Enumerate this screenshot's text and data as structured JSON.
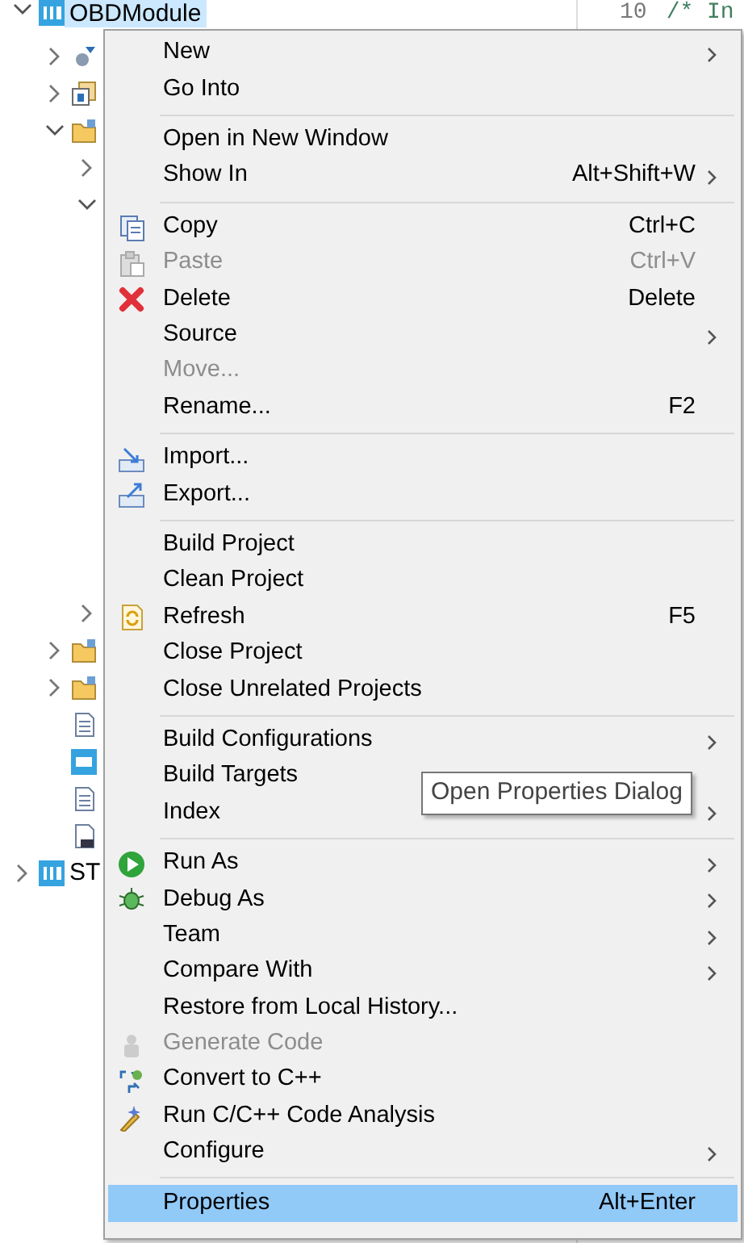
{
  "tree": [
    {
      "label": "OBDModule",
      "selected": true,
      "expanded": true,
      "children": [
        {
          "expanded": false,
          "selected": false
        },
        {
          "expanded": false,
          "selected": false
        },
        {
          "expanded": true,
          "selected": false,
          "children": [
            {
              "expanded": false,
              "selected": false
            },
            {
              "expanded": true,
              "selected": false
            },
            {
              "expanded": false,
              "selected": false
            }
          ]
        },
        {
          "expanded": false,
          "selected": false
        },
        {
          "expanded": false,
          "selected": false
        },
        {
          "selected": false
        },
        {
          "selected": false
        },
        {
          "selected": false
        },
        {
          "selected": false
        }
      ]
    },
    {
      "label": "ST",
      "selected": false,
      "expanded": false
    }
  ],
  "editor": {
    "line_number": "10",
    "code": "/* In"
  },
  "context_menu": [
    {
      "kind": "item",
      "label": "New",
      "submenu": true,
      "disabled": false,
      "selected": false
    },
    {
      "kind": "item",
      "label": "Go Into",
      "submenu": false,
      "disabled": false,
      "selected": false
    },
    {
      "kind": "separator"
    },
    {
      "kind": "item",
      "label": "Open in New Window",
      "submenu": false,
      "disabled": false,
      "selected": false
    },
    {
      "kind": "item",
      "label": "Show In",
      "shortcut": "Alt+Shift+W",
      "submenu": true,
      "disabled": false,
      "selected": false
    },
    {
      "kind": "separator"
    },
    {
      "kind": "item",
      "label": "Copy",
      "shortcut": "Ctrl+C",
      "submenu": false,
      "disabled": false,
      "selected": false
    },
    {
      "kind": "item",
      "label": "Paste",
      "shortcut": "Ctrl+V",
      "submenu": false,
      "disabled": true,
      "selected": false
    },
    {
      "kind": "item",
      "label": "Delete",
      "shortcut": "Delete",
      "submenu": false,
      "disabled": false,
      "selected": false
    },
    {
      "kind": "item",
      "label": "Source",
      "submenu": true,
      "disabled": false,
      "selected": false
    },
    {
      "kind": "item",
      "label": "Move...",
      "submenu": false,
      "disabled": true,
      "selected": false
    },
    {
      "kind": "item",
      "label": "Rename...",
      "shortcut": "F2",
      "submenu": false,
      "disabled": false,
      "selected": false
    },
    {
      "kind": "separator"
    },
    {
      "kind": "item",
      "label": "Import...",
      "submenu": false,
      "disabled": false,
      "selected": false
    },
    {
      "kind": "item",
      "label": "Export...",
      "submenu": false,
      "disabled": false,
      "selected": false
    },
    {
      "kind": "separator"
    },
    {
      "kind": "item",
      "label": "Build Project",
      "submenu": false,
      "disabled": false,
      "selected": false
    },
    {
      "kind": "item",
      "label": "Clean Project",
      "submenu": false,
      "disabled": false,
      "selected": false
    },
    {
      "kind": "item",
      "label": "Refresh",
      "shortcut": "F5",
      "submenu": false,
      "disabled": false,
      "selected": false
    },
    {
      "kind": "item",
      "label": "Close Project",
      "submenu": false,
      "disabled": false,
      "selected": false
    },
    {
      "kind": "item",
      "label": "Close Unrelated Projects",
      "submenu": false,
      "disabled": false,
      "selected": false
    },
    {
      "kind": "separator"
    },
    {
      "kind": "item",
      "label": "Build Configurations",
      "submenu": true,
      "disabled": false,
      "selected": false
    },
    {
      "kind": "item",
      "label": "Build Targets",
      "submenu": false,
      "disabled": false,
      "selected": false
    },
    {
      "kind": "item",
      "label": "Index",
      "submenu": true,
      "disabled": false,
      "selected": false
    },
    {
      "kind": "separator"
    },
    {
      "kind": "item",
      "label": "Run As",
      "submenu": true,
      "disabled": false,
      "selected": false
    },
    {
      "kind": "item",
      "label": "Debug As",
      "submenu": true,
      "disabled": false,
      "selected": false
    },
    {
      "kind": "item",
      "label": "Team",
      "submenu": true,
      "disabled": false,
      "selected": false
    },
    {
      "kind": "item",
      "label": "Compare With",
      "submenu": true,
      "disabled": false,
      "selected": false
    },
    {
      "kind": "item",
      "label": "Restore from Local History...",
      "submenu": false,
      "disabled": false,
      "selected": false
    },
    {
      "kind": "item",
      "label": "Generate Code",
      "submenu": false,
      "disabled": true,
      "selected": false
    },
    {
      "kind": "item",
      "label": "Convert to C++",
      "submenu": false,
      "disabled": false,
      "selected": false
    },
    {
      "kind": "item",
      "label": "Run C/C++ Code Analysis",
      "submenu": false,
      "disabled": false,
      "selected": false
    },
    {
      "kind": "item",
      "label": "Configure",
      "submenu": true,
      "disabled": false,
      "selected": false
    },
    {
      "kind": "separator"
    },
    {
      "kind": "item",
      "label": "Properties",
      "shortcut": "Alt+Enter",
      "submenu": false,
      "disabled": false,
      "selected": true
    }
  ],
  "tooltip": {
    "text": "Open Properties Dialog"
  }
}
